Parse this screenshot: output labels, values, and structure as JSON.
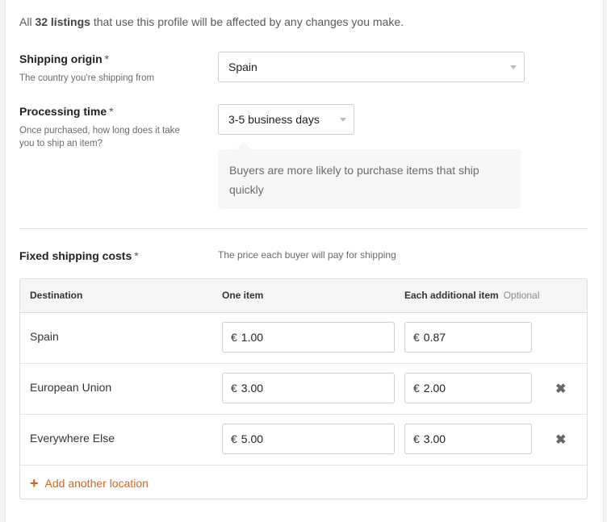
{
  "intro": {
    "prefix": "All",
    "count_text": "32 listings",
    "suffix": "that use this profile will be affected by any changes you make."
  },
  "shipping_origin": {
    "label": "Shipping origin",
    "required_mark": "*",
    "help": "The country you're shipping from",
    "value": "Spain"
  },
  "processing_time": {
    "label": "Processing time",
    "required_mark": "*",
    "help": "Once purchased, how long does it take you to ship an item?",
    "value": "3-5 business days",
    "tip": "Buyers are more likely to purchase items that ship quickly"
  },
  "fixed_costs": {
    "label": "Fixed shipping costs",
    "required_mark": "*",
    "help": "The price each buyer will pay for shipping"
  },
  "table": {
    "headers": {
      "destination": "Destination",
      "one_item": "One item",
      "additional": "Each additional item",
      "optional": "Optional"
    },
    "currency": "€",
    "rows": [
      {
        "destination": "Spain",
        "one_item": "1.00",
        "additional": "0.87",
        "removable": false
      },
      {
        "destination": "European Union",
        "one_item": "3.00",
        "additional": "2.00",
        "removable": true
      },
      {
        "destination": "Everywhere Else",
        "one_item": "5.00",
        "additional": "3.00",
        "removable": true
      }
    ],
    "remove_glyph": "✖",
    "add_plus": "+",
    "add_label": "Add another location"
  },
  "colors": {
    "accent": "#d5641c",
    "tip_background": "#f6f6f4"
  }
}
